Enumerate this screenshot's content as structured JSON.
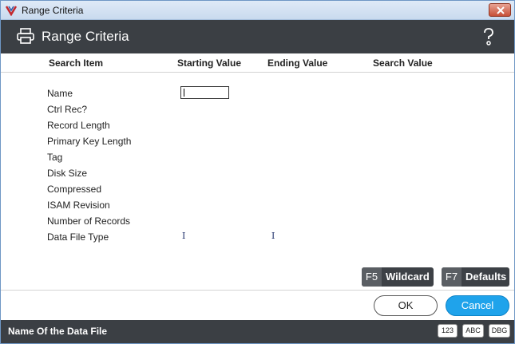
{
  "window": {
    "title": "Range Criteria"
  },
  "header": {
    "title": "Range Criteria",
    "left_icon": "printer-icon",
    "right_icon": "help-icon"
  },
  "columns": [
    "Search Item",
    "Starting Value",
    "Ending Value",
    "Search Value"
  ],
  "fields": [
    "Name",
    "Ctrl Rec?",
    "Record Length",
    "Primary Key Length",
    "Tag",
    "Disk Size",
    "Compressed",
    "ISAM Revision",
    "Number of Records",
    "Data File Type"
  ],
  "inputs": {
    "name_start_value": ""
  },
  "function_keys": [
    {
      "key": "F5",
      "label": "Wildcard"
    },
    {
      "key": "F7",
      "label": "Defaults"
    }
  ],
  "buttons": {
    "ok": "OK",
    "cancel": "Cancel"
  },
  "status": {
    "text": "Name Of the Data File",
    "badges": [
      "123",
      "ABC",
      "DBG"
    ]
  },
  "colors": {
    "header_bg": "#3b3f44",
    "accent": "#1fa3eb",
    "titlebar": "#c9daee"
  }
}
